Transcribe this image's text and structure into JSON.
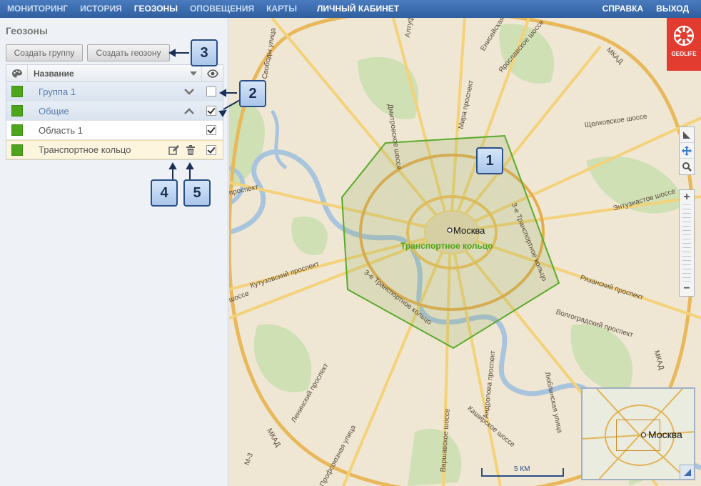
{
  "nav": {
    "items": [
      "МОНИТОРИНГ",
      "ИСТОРИЯ",
      "ГЕОЗОНЫ",
      "ОПОВЕЩЕНИЯ",
      "КАРТЫ"
    ],
    "active": "ГЕОЗОНЫ",
    "account": "ЛИЧНЫЙ КАБИНЕТ",
    "help": "СПРАВКА",
    "logout": "ВЫХОД"
  },
  "panel": {
    "title": "Геозоны",
    "create_group": "Создать группу",
    "create_zone": "Создать геозону",
    "column_name": "Название",
    "rows": [
      {
        "label": "Группа 1",
        "type": "group",
        "expanded": false,
        "visible": false,
        "color": "#4ca51a"
      },
      {
        "label": "Общие",
        "type": "group",
        "expanded": true,
        "visible": true,
        "color": "#4ca51a"
      },
      {
        "label": "Область 1",
        "type": "zone",
        "visible": true,
        "color": "#4ca51a"
      },
      {
        "label": "Транспортное кольцо",
        "type": "zone",
        "visible": true,
        "selected": true,
        "color": "#4ca51a"
      }
    ]
  },
  "callouts": [
    "1",
    "2",
    "3",
    "4",
    "5"
  ],
  "map": {
    "city": "Москва",
    "zone_label": "Транспортное кольцо",
    "scale": "5 КМ",
    "minimap_city": "Москва",
    "brand": "GEOLIFE",
    "roads": {
      "a": "Алтуфьевское шоссе",
      "svobody": "Свободы улица",
      "dmitrov": "Дмитровское шоссе",
      "mira": "Мира проспект",
      "yaroslav": "Ярославское шоссе",
      "eniseyskaya": "Енисейская",
      "mkad": "МКАД",
      "shchelk": "Щелковское шоссе",
      "entuz": "Энтузиастов шоссе",
      "ryazan": "Рязанский проспект",
      "volgograd": "Волгоградский проспект",
      "kutuz": "Кутузовский проспект",
      "minsk": "Минское шоссе",
      "ring3_w": "3-е Транспортное кольцо",
      "ring3_e": "3-е Транспортное кольцо",
      "lenin": "Ленинский проспект",
      "profsoyuz": "Профсоюзная улица",
      "varshav": "Варшавское шоссе",
      "andropov": "Андропова проспект",
      "kashir": "Каширское шоссе",
      "lyublin": "Люблинская улица",
      "m3": "М-3",
      "mkad_sw": "МКАД",
      "mkad_e": "МКАД",
      "shosse_w": "шоссе",
      "prospekt_w": "проспект"
    }
  },
  "colors": {
    "accent": "#3a6cb0",
    "zone": "#4ca51a",
    "brand": "#e23c30"
  },
  "icons": {
    "palette": "palette-icon",
    "eye": "eye-icon",
    "edit": "edit-icon",
    "trash": "trash-icon"
  }
}
